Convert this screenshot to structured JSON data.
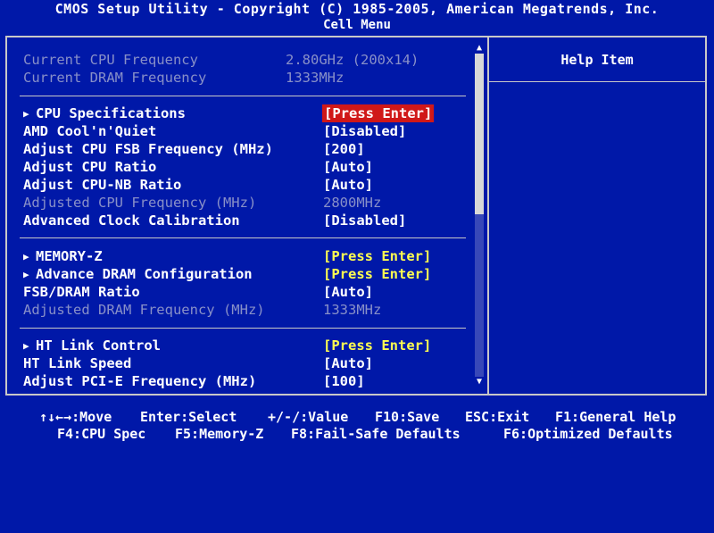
{
  "header": {
    "title": "CMOS Setup Utility - Copyright (C) 1985-2005, American Megatrends, Inc.",
    "subtitle": "Cell Menu"
  },
  "help_panel": {
    "title": "Help Item"
  },
  "info": [
    {
      "label": "Current CPU Frequency",
      "value": "2.80GHz (200x14)"
    },
    {
      "label": "Current DRAM Frequency",
      "value": "1333MHz"
    }
  ],
  "settings": {
    "cpu_specifications": {
      "label": "CPU Specifications",
      "value": "[Press Enter]"
    },
    "amd_cool_n_quiet": {
      "label": "AMD Cool'n'Quiet",
      "value": "[Disabled]"
    },
    "adjust_cpu_fsb": {
      "label": "Adjust CPU FSB Frequency (MHz)",
      "value": "[200]"
    },
    "adjust_cpu_ratio": {
      "label": "Adjust CPU Ratio",
      "value": "[Auto]"
    },
    "adjust_cpu_nb_ratio": {
      "label": "Adjust CPU-NB Ratio",
      "value": "[Auto]"
    },
    "adjusted_cpu_frequency": {
      "label": "Adjusted CPU Frequency (MHz)",
      "value": "2800MHz"
    },
    "advanced_clock_calibration": {
      "label": "Advanced Clock Calibration",
      "value": "[Disabled]"
    },
    "memory_z": {
      "label": "MEMORY-Z",
      "value": "[Press Enter]"
    },
    "advance_dram_configuration": {
      "label": "Advance DRAM Configuration",
      "value": "[Press Enter]"
    },
    "fsb_dram_ratio": {
      "label": "FSB/DRAM Ratio",
      "value": "[Auto]"
    },
    "adjusted_dram_frequency": {
      "label": "Adjusted DRAM Frequency (MHz)",
      "value": "1333MHz"
    },
    "ht_link_control": {
      "label": "HT Link Control",
      "value": "[Press Enter]"
    },
    "ht_link_speed": {
      "label": "HT Link Speed",
      "value": "[Auto]"
    },
    "adjust_pcie_frequency": {
      "label": "Adjust PCI-E Frequency (MHz)",
      "value": "[100]"
    }
  },
  "footer": {
    "line1": {
      "move": "↑↓←→:Move",
      "select": "Enter:Select",
      "value": "+/-/:Value",
      "save": "F10:Save",
      "exit": "ESC:Exit",
      "help": "F1:General Help"
    },
    "line2": {
      "cpu_spec": "F4:CPU Spec",
      "memory_z": "F5:Memory-Z",
      "failsafe": "F8:Fail-Safe Defaults",
      "optimized": "F6:Optimized Defaults"
    }
  },
  "colors": {
    "background": "#0018a8",
    "highlight": "#d01818",
    "submenu_value": "#ffff50",
    "disabled_text": "#8890c8"
  },
  "icons": {
    "submenu_arrow": "right-triangle-icon",
    "scroll_up": "up-triangle-icon",
    "scroll_down": "down-triangle-icon"
  }
}
